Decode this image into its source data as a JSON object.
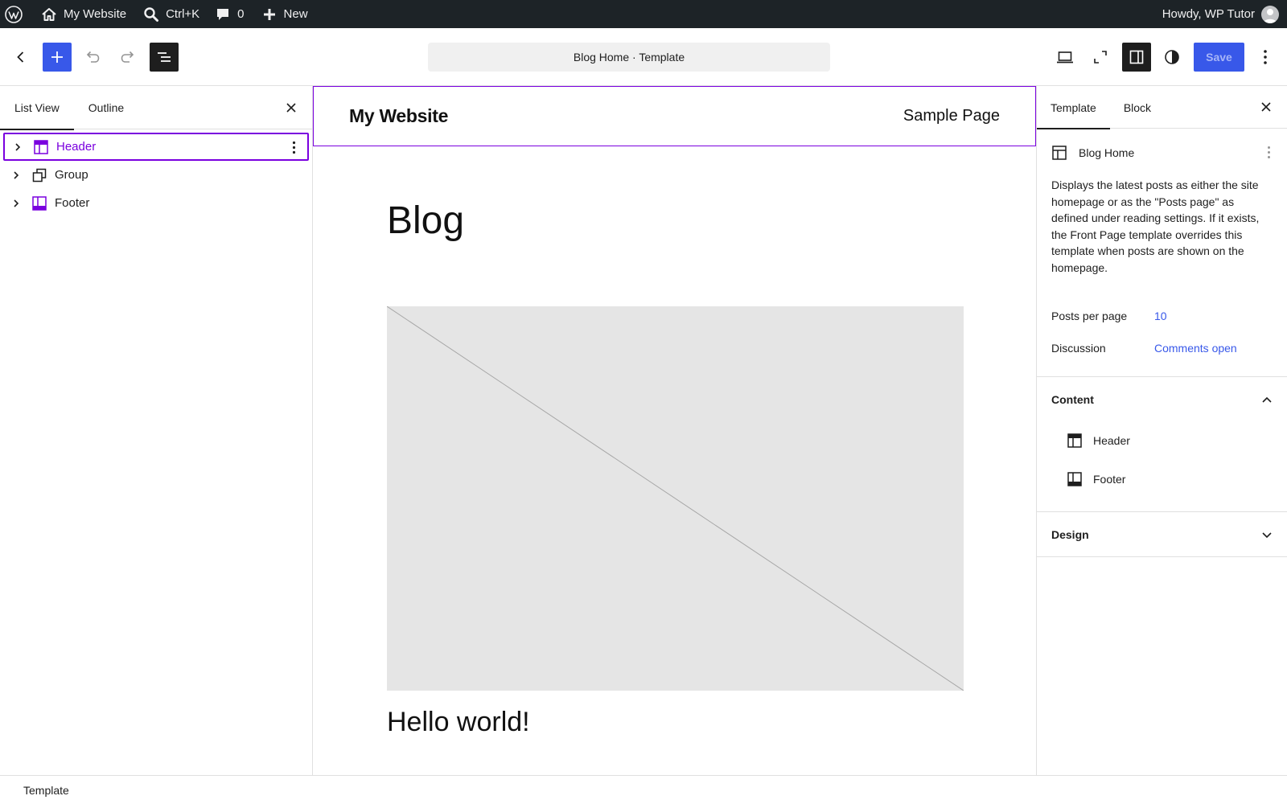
{
  "admin_bar": {
    "site_name": "My Website",
    "search_shortcut": "Ctrl+K",
    "comments_count": "0",
    "new_label": "New",
    "greeting": "Howdy, WP Tutor"
  },
  "editor_header": {
    "document_title": "Blog Home · Template",
    "save_label": "Save"
  },
  "list_view": {
    "tabs": [
      {
        "label": "List View"
      },
      {
        "label": "Outline"
      }
    ],
    "blocks": [
      {
        "label": "Header"
      },
      {
        "label": "Group"
      },
      {
        "label": "Footer"
      }
    ]
  },
  "canvas": {
    "site_title": "My Website",
    "nav_link": "Sample Page",
    "page_heading": "Blog",
    "post_title": "Hello world!"
  },
  "settings": {
    "tabs": [
      {
        "label": "Template"
      },
      {
        "label": "Block"
      }
    ],
    "template_name": "Blog Home",
    "description": "Displays the latest posts as either the site homepage or as the \"Posts page\" as defined under reading settings. If it exists, the Front Page template overrides this template when posts are shown on the homepage.",
    "properties": [
      {
        "label": "Posts per page",
        "value": "10"
      },
      {
        "label": "Discussion",
        "value": "Comments open"
      }
    ],
    "content_section": {
      "title": "Content",
      "items": [
        {
          "label": "Header"
        },
        {
          "label": "Footer"
        }
      ]
    },
    "design_section": {
      "title": "Design"
    }
  },
  "footer_bar": {
    "breadcrumb": "Template"
  },
  "colors": {
    "accent_blue": "#3858e9",
    "selection_purple": "#7a00df",
    "admin_bar_bg": "#1d2327"
  }
}
